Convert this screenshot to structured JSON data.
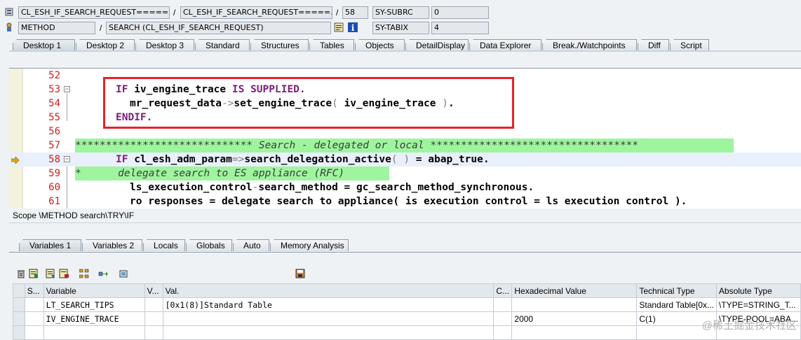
{
  "header": {
    "row1": {
      "program": "CL_ESH_IF_SEARCH_REQUEST=====...",
      "include": "CL_ESH_IF_SEARCH_REQUEST=====...",
      "line": "58",
      "subrc_label": "SY-SUBRC",
      "subrc_value": "0"
    },
    "row2": {
      "type": "METHOD",
      "event": "SEARCH (CL_ESH_IF_SEARCH_REQUEST)",
      "tabix_label": "SY-TABIX",
      "tabix_value": "4"
    }
  },
  "tabs": [
    "Desktop 1",
    "Desktop 2",
    "Desktop 3",
    "Standard",
    "Structures",
    "Tables",
    "Objects",
    "DetailDisplay",
    "Data Explorer",
    "Break./Watchpoints",
    "Diff",
    "Script"
  ],
  "code_lines": [
    {
      "num": "52",
      "text": ""
    },
    {
      "num": "53",
      "text": "IF iv_engine_trace IS SUPPLIED."
    },
    {
      "num": "54",
      "text": "mr_request_data->set_engine_trace( iv_engine_trace )."
    },
    {
      "num": "55",
      "text": "ENDIF."
    },
    {
      "num": "56",
      "text": ""
    },
    {
      "num": "57",
      "text": "***************************** Search - delegated or local **********************************"
    },
    {
      "num": "58",
      "text": "IF cl_esh_adm_param=>search_delegation_active( ) = abap_true."
    },
    {
      "num": "59",
      "text": "*      delegate search to ES appliance (RFC)"
    },
    {
      "num": "60",
      "text": "ls_execution_control-search_method = gc_search_method_synchronous."
    },
    {
      "num": "61",
      "text": "ro responses = delegate search to appliance( is execution control = ls execution control )."
    }
  ],
  "scope": "Scope \\METHOD search\\TRY\\IF",
  "var_tabs": [
    "Variables 1",
    "Variables 2",
    "Locals",
    "Globals",
    "Auto",
    "Memory Analysis"
  ],
  "grid": {
    "headers": [
      "S...",
      "Variable",
      "V...",
      "Val.",
      "C...",
      "Hexadecimal Value",
      "Technical Type",
      "Absolute Type"
    ],
    "rows": [
      {
        "variable": "LT_SEARCH_TIPS",
        "val": "[0x1(8)]Standard Table",
        "hex": "",
        "tech": "Standard Table[0x...",
        "abs": "\\TYPE=STRING_T..."
      },
      {
        "variable": "IV_ENGINE_TRACE",
        "val": "",
        "hex": "2000",
        "tech": "C(1)",
        "abs": "\\TYPE-POOL=ABA..."
      }
    ]
  },
  "watermark": "@稀土掘金技术社区",
  "colors": {
    "highlight_box": "#e8212a",
    "comment_bg": "#9ef59e",
    "line_number": "#d02020",
    "keyword": "#7a1f7a"
  }
}
